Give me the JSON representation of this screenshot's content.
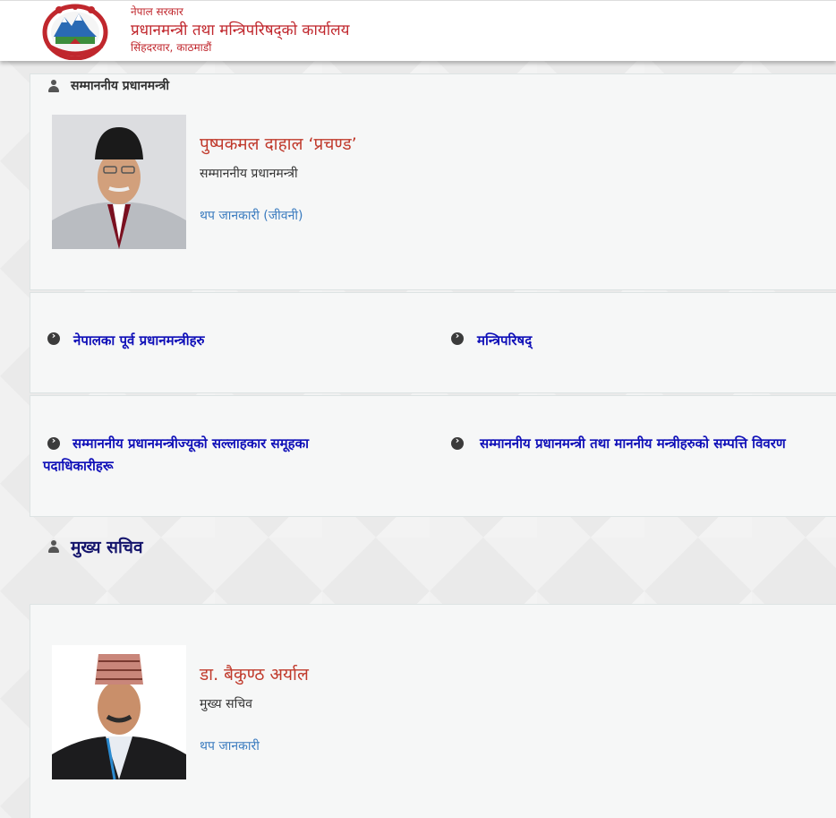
{
  "header": {
    "gov": "नेपाल सरकार",
    "office": "प्रधानमन्त्री तथा मन्त्रिपरिषद्को कार्यालय",
    "address": "सिंहदरवार, काठमाडौं"
  },
  "pm_section": {
    "heading": "सम्माननीय प्रधानमन्त्री",
    "name": "पुष्पकमल दाहाल ‘प्रचण्ड’",
    "role": "सम्माननीय प्रधानमन्त्री",
    "more_link": "थप जानकारी (जीवनी)"
  },
  "links_row1": [
    "नेपालका पूर्व प्रधानमन्त्रीहरु",
    "मन्त्रिपरिषद्"
  ],
  "links_row2": [
    "सम्माननीय प्रधानमन्त्रीज्यूको सल्लाहकार समूहका पदाधिकारीहरू",
    "सम्माननीय प्रधानमन्त्री तथा माननीय मन्त्रीहरुको सम्पत्ति विवरण"
  ],
  "secretary_section": {
    "heading": "मुख्य सचिव",
    "name": "डा. बैकुण्ठ अर्याल",
    "role": "मुख्य सचिव",
    "more_link": "थप जानकारी"
  },
  "colors": {
    "brand_red": "#c0272d",
    "link_blue": "#1010b8",
    "info_blue": "#3a7bbf"
  },
  "icons": [
    "nepal-emblem-icon",
    "user-icon",
    "arrow-circle-right-icon"
  ]
}
